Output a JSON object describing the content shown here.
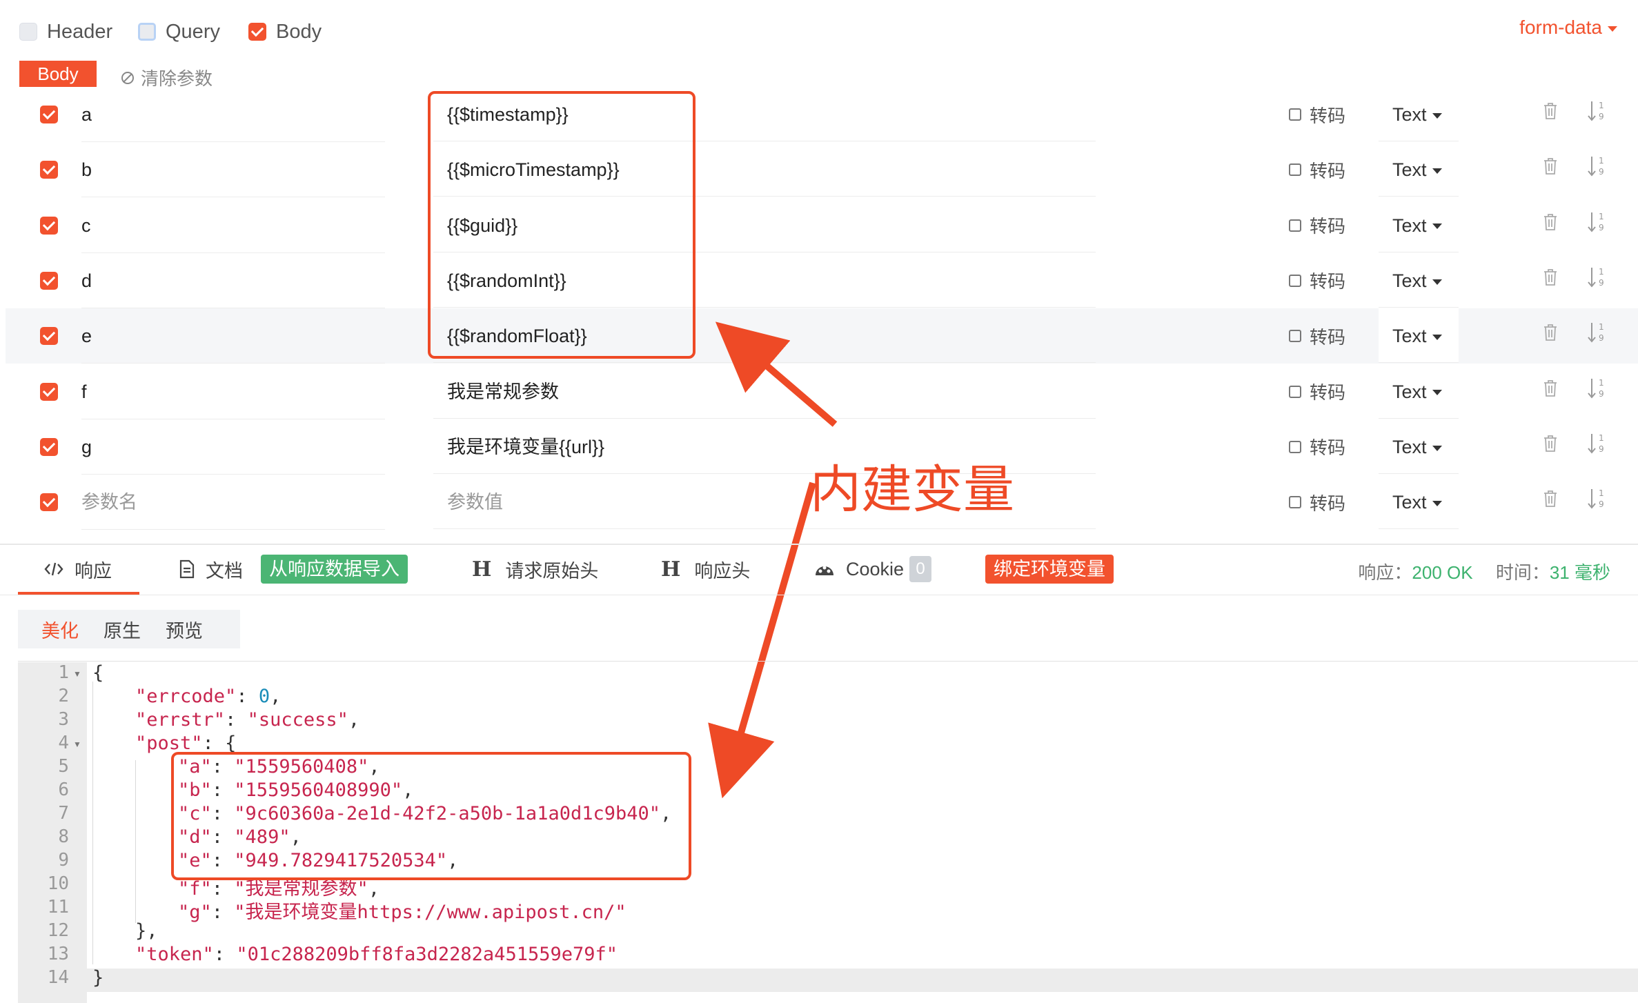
{
  "top_tabs": [
    {
      "label": "Header",
      "state": "off"
    },
    {
      "label": "Query",
      "state": "ring"
    },
    {
      "label": "Body",
      "state": "on"
    }
  ],
  "body_type": "form-data",
  "body_badge": "Body",
  "clear_params": "清除参数",
  "rows": [
    {
      "name": "a",
      "value": "{{$timestamp}}"
    },
    {
      "name": "b",
      "value": "{{$microTimestamp}}"
    },
    {
      "name": "c",
      "value": "{{$guid}}"
    },
    {
      "name": "d",
      "value": "{{$randomInt}}"
    },
    {
      "name": "e",
      "value": "{{$randomFloat}}"
    },
    {
      "name": "f",
      "value": "我是常规参数"
    },
    {
      "name": "g",
      "value": "我是环境变量{{url}}"
    }
  ],
  "placeholder_row": {
    "name": "参数名",
    "value": "参数值"
  },
  "encode_label": "转码",
  "type_label": "Text",
  "annotation": "内建变量",
  "response_tabs": {
    "response": "响应",
    "docs": "文档",
    "import_btn": "从响应数据导入",
    "req_headers": "请求原始头",
    "resp_headers": "响应头",
    "cookie": "Cookie",
    "cookie_count": "0",
    "bind_env_btn": "绑定环境变量"
  },
  "status": {
    "response_label": "响应：",
    "response_value": "200 OK",
    "time_label": "时间：",
    "time_value": "31 毫秒"
  },
  "view_tabs": {
    "pretty": "美化",
    "raw": "原生",
    "preview": "预览"
  },
  "code_lines": [
    {
      "n": "1",
      "indent": 0,
      "open": "{"
    },
    {
      "n": "2",
      "indent": 1,
      "key": "\"errcode\"",
      "val": "0",
      "vtype": "n",
      "tail": ","
    },
    {
      "n": "3",
      "indent": 1,
      "key": "\"errstr\"",
      "val": "\"success\"",
      "vtype": "s",
      "tail": ","
    },
    {
      "n": "4",
      "indent": 1,
      "key": "\"post\"",
      "val": "{",
      "vtype": "p",
      "tail": ""
    },
    {
      "n": "5",
      "indent": 2,
      "key": "\"a\"",
      "val": "\"1559560408\"",
      "vtype": "s",
      "tail": ","
    },
    {
      "n": "6",
      "indent": 2,
      "key": "\"b\"",
      "val": "\"1559560408990\"",
      "vtype": "s",
      "tail": ","
    },
    {
      "n": "7",
      "indent": 2,
      "key": "\"c\"",
      "val": "\"9c60360a-2e1d-42f2-a50b-1a1a0d1c9b40\"",
      "vtype": "s",
      "tail": ","
    },
    {
      "n": "8",
      "indent": 2,
      "key": "\"d\"",
      "val": "\"489\"",
      "vtype": "s",
      "tail": ","
    },
    {
      "n": "9",
      "indent": 2,
      "key": "\"e\"",
      "val": "\"949.7829417520534\"",
      "vtype": "s",
      "tail": ","
    },
    {
      "n": "10",
      "indent": 2,
      "key": "\"f\"",
      "val": "\"我是常规参数\"",
      "vtype": "s",
      "tail": ","
    },
    {
      "n": "11",
      "indent": 2,
      "key": "\"g\"",
      "val": "\"我是环境变量https://www.apipost.cn/\"",
      "vtype": "s",
      "tail": ""
    },
    {
      "n": "12",
      "indent": 1,
      "open": "},"
    },
    {
      "n": "13",
      "indent": 1,
      "key": "\"token\"",
      "val": "\"01c288209bff8fa3d2282a451559e79f\"",
      "vtype": "s",
      "tail": ""
    },
    {
      "n": "14",
      "indent": 0,
      "open": "}"
    }
  ],
  "colors": {
    "accent": "#f2522e",
    "green": "#4bb574",
    "string": "#c7254e",
    "number": "#1a8cb8"
  },
  "icons": [
    "checkbox-icon",
    "clear-icon",
    "trash-icon",
    "sort-icon",
    "code-icon",
    "document-icon",
    "header-icon",
    "cookie-icon",
    "arrow-icon"
  ]
}
